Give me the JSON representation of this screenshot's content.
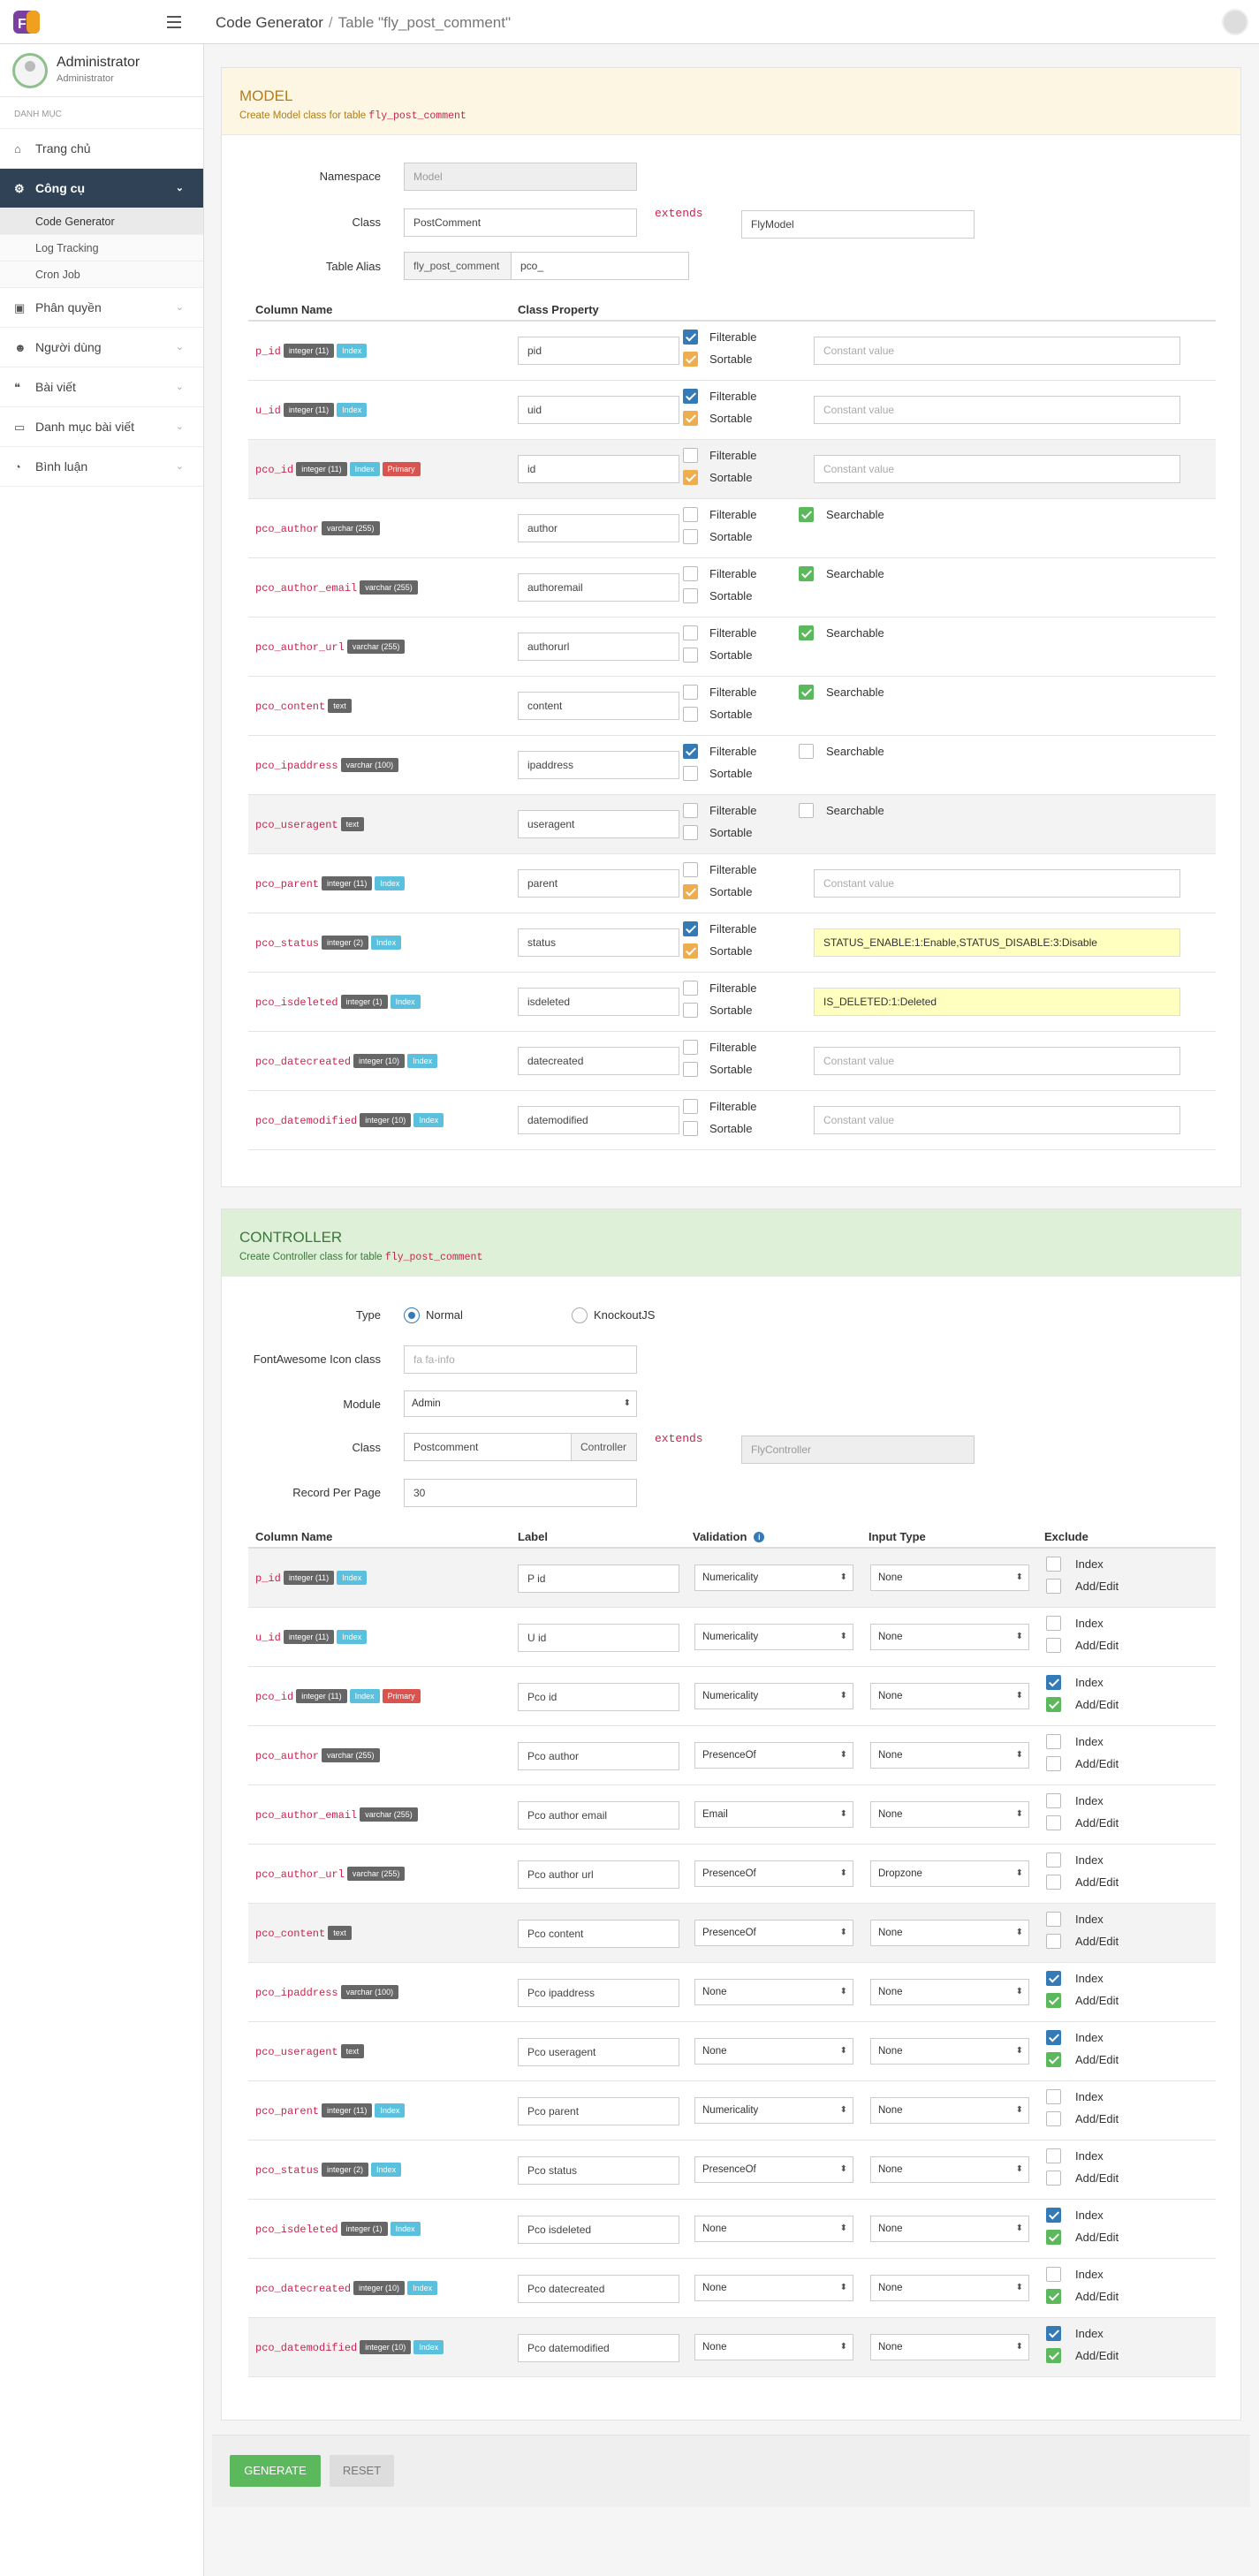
{
  "header": {
    "breadcrumb_root": "Code Generator",
    "breadcrumb_separator": "/",
    "breadcrumb_current": "Table \"fly_post_comment\""
  },
  "user": {
    "name": "Administrator",
    "role": "Administrator"
  },
  "sidebar": {
    "section_title": "DANH MỤC",
    "items": [
      {
        "label": "Trang chủ",
        "icon": "home-icon",
        "glyph": "⌂",
        "chevron": false
      },
      {
        "label": "Công cụ",
        "icon": "cogs-icon",
        "glyph": "⚙",
        "chevron": true,
        "active": true,
        "children": [
          "Code Generator",
          "Log Tracking",
          "Cron Job"
        ]
      },
      {
        "label": "Phân quyền",
        "icon": "briefcase-icon",
        "glyph": "▣",
        "chevron": true
      },
      {
        "label": "Người dùng",
        "icon": "users-icon",
        "glyph": "☻",
        "chevron": true
      },
      {
        "label": "Bài viết",
        "icon": "quote-icon",
        "glyph": "❝",
        "chevron": true
      },
      {
        "label": "Danh mục bài viết",
        "icon": "folder-icon",
        "glyph": "▭",
        "chevron": true
      },
      {
        "label": "Bình luận",
        "icon": "comment-icon",
        "glyph": "◔",
        "chevron": true
      }
    ]
  },
  "model": {
    "title": "MODEL",
    "subtitle_prefix": "Create Model class for table",
    "table_name": "fly_post_comment",
    "namespace_label": "Namespace",
    "namespace_value": "Model",
    "class_label": "Class",
    "class_value": "PostComment",
    "extends_keyword": "extends",
    "extends_value": "FlyModel",
    "alias_label": "Table Alias",
    "alias_table": "fly_post_comment",
    "alias_value": "pco_",
    "col_name_header": "Column Name",
    "col_prop_header": "Class Property",
    "filterable_label": "Filterable",
    "sortable_label": "Sortable",
    "searchable_label": "Searchable",
    "rows": [
      {
        "name": "p_id",
        "type": "integer (11)",
        "index": true,
        "primary": false,
        "prop": "pid",
        "filter": true,
        "sort": true,
        "mode": "const",
        "const": ""
      },
      {
        "name": "u_id",
        "type": "integer (11)",
        "index": true,
        "primary": false,
        "prop": "uid",
        "filter": true,
        "sort": true,
        "mode": "const",
        "const": ""
      },
      {
        "name": "pco_id",
        "type": "integer (11)",
        "index": true,
        "primary": true,
        "prop": "id",
        "filter": false,
        "sort": true,
        "mode": "const",
        "const": ""
      },
      {
        "name": "pco_author",
        "type": "varchar (255)",
        "index": false,
        "primary": false,
        "prop": "author",
        "filter": false,
        "sort": false,
        "mode": "search",
        "search": true
      },
      {
        "name": "pco_author_email",
        "type": "varchar (255)",
        "index": false,
        "primary": false,
        "prop": "authoremail",
        "filter": false,
        "sort": false,
        "mode": "search",
        "search": true
      },
      {
        "name": "pco_author_url",
        "type": "varchar (255)",
        "index": false,
        "primary": false,
        "prop": "authorurl",
        "filter": false,
        "sort": false,
        "mode": "search",
        "search": true
      },
      {
        "name": "pco_content",
        "type": "text",
        "index": false,
        "primary": false,
        "prop": "content",
        "filter": false,
        "sort": false,
        "mode": "search",
        "search": true
      },
      {
        "name": "pco_ipaddress",
        "type": "varchar (100)",
        "index": false,
        "primary": false,
        "prop": "ipaddress",
        "filter": true,
        "sort": false,
        "mode": "search",
        "search": false
      },
      {
        "name": "pco_useragent",
        "type": "text",
        "index": false,
        "primary": false,
        "prop": "useragent",
        "filter": false,
        "sort": false,
        "mode": "search",
        "search": false
      },
      {
        "name": "pco_parent",
        "type": "integer (11)",
        "index": true,
        "primary": false,
        "prop": "parent",
        "filter": false,
        "sort": true,
        "mode": "const",
        "const": ""
      },
      {
        "name": "pco_status",
        "type": "integer (2)",
        "index": true,
        "primary": false,
        "prop": "status",
        "filter": true,
        "sort": true,
        "mode": "const",
        "const": "STATUS_ENABLE:1:Enable,STATUS_DISABLE:3:Disable"
      },
      {
        "name": "pco_isdeleted",
        "type": "integer (1)",
        "index": true,
        "primary": false,
        "prop": "isdeleted",
        "filter": false,
        "sort": false,
        "mode": "const",
        "const": "IS_DELETED:1:Deleted"
      },
      {
        "name": "pco_datecreated",
        "type": "integer (10)",
        "index": true,
        "primary": false,
        "prop": "datecreated",
        "filter": false,
        "sort": false,
        "mode": "const",
        "const": ""
      },
      {
        "name": "pco_datemodified",
        "type": "integer (10)",
        "index": true,
        "primary": false,
        "prop": "datemodified",
        "filter": false,
        "sort": false,
        "mode": "const",
        "const": ""
      }
    ],
    "const_placeholder": "Constant value",
    "index_badge": "Index",
    "primary_badge": "Primary"
  },
  "controller": {
    "title": "CONTROLLER",
    "subtitle_prefix": "Create Controller class for table",
    "table_name": "fly_post_comment",
    "type_label": "Type",
    "type_normal": "Normal",
    "type_knockout": "KnockoutJS",
    "icon_label": "FontAwesome Icon class",
    "icon_placeholder": "fa fa-info",
    "module_label": "Module",
    "module_value": "Admin",
    "class_label": "Class",
    "class_value": "Postcomment",
    "class_suffix": "Controller",
    "extends_keyword": "extends",
    "extends_value": "FlyController",
    "rpp_label": "Record Per Page",
    "rpp_value": "30",
    "h_col": "Column Name",
    "h_label": "Label",
    "h_validation": "Validation",
    "h_input": "Input Type",
    "h_exclude": "Exclude",
    "index_label": "Index",
    "addedit_label": "Add/Edit",
    "rows": [
      {
        "label": "P id",
        "validation": "Numericality",
        "input": "None",
        "ex_index": false,
        "ex_add": false
      },
      {
        "label": "U id",
        "validation": "Numericality",
        "input": "None",
        "ex_index": false,
        "ex_add": false
      },
      {
        "label": "Pco id",
        "validation": "Numericality",
        "input": "None",
        "ex_index": true,
        "ex_add": true
      },
      {
        "label": "Pco author",
        "validation": "PresenceOf",
        "input": "None",
        "ex_index": false,
        "ex_add": false
      },
      {
        "label": "Pco author email",
        "validation": "Email",
        "input": "None",
        "ex_index": false,
        "ex_add": false
      },
      {
        "label": "Pco author url",
        "validation": "PresenceOf",
        "input": "Dropzone",
        "ex_index": false,
        "ex_add": false
      },
      {
        "label": "Pco content",
        "validation": "PresenceOf",
        "input": "None",
        "ex_index": false,
        "ex_add": false
      },
      {
        "label": "Pco ipaddress",
        "validation": "None",
        "input": "None",
        "ex_index": true,
        "ex_add": true
      },
      {
        "label": "Pco useragent",
        "validation": "None",
        "input": "None",
        "ex_index": true,
        "ex_add": true
      },
      {
        "label": "Pco parent",
        "validation": "Numericality",
        "input": "None",
        "ex_index": false,
        "ex_add": false
      },
      {
        "label": "Pco status",
        "validation": "PresenceOf",
        "input": "None",
        "ex_index": false,
        "ex_add": false
      },
      {
        "label": "Pco isdeleted",
        "validation": "None",
        "input": "None",
        "ex_index": true,
        "ex_add": true
      },
      {
        "label": "Pco datecreated",
        "validation": "None",
        "input": "None",
        "ex_index": false,
        "ex_add": true
      },
      {
        "label": "Pco datemodified",
        "validation": "None",
        "input": "None",
        "ex_index": true,
        "ex_add": true
      }
    ]
  },
  "buttons": {
    "generate": "GENERATE",
    "reset": "RESET"
  }
}
